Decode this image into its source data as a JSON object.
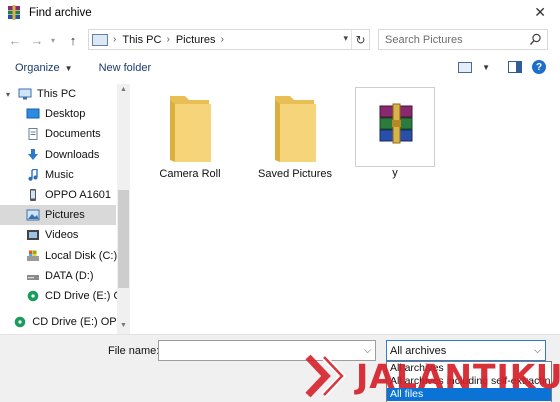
{
  "window": {
    "title": "Find archive"
  },
  "nav": {
    "breadcrumbs": [
      "This PC",
      "Pictures"
    ],
    "search_placeholder": "Search Pictures"
  },
  "toolbar": {
    "organize_label": "Organize",
    "new_folder_label": "New folder"
  },
  "sidebar": {
    "items": [
      {
        "label": "This PC",
        "icon": "computer-icon",
        "level": 0
      },
      {
        "label": "Desktop",
        "icon": "desktop-icon",
        "level": 1
      },
      {
        "label": "Documents",
        "icon": "documents-icon",
        "level": 1
      },
      {
        "label": "Downloads",
        "icon": "downloads-icon",
        "level": 1
      },
      {
        "label": "Music",
        "icon": "music-icon",
        "level": 1
      },
      {
        "label": "OPPO A1601",
        "icon": "phone-icon",
        "level": 1
      },
      {
        "label": "Pictures",
        "icon": "pictures-icon",
        "level": 1,
        "selected": true
      },
      {
        "label": "Videos",
        "icon": "videos-icon",
        "level": 1
      },
      {
        "label": "Local Disk (C:)",
        "icon": "local-disk-icon",
        "level": 1
      },
      {
        "label": "DATA (D:)",
        "icon": "drive-icon",
        "level": 1
      },
      {
        "label": "CD Drive (E:) OP",
        "icon": "cd-drive-icon",
        "level": 1
      },
      {
        "label": "CD Drive (E:) OPP",
        "icon": "cd-drive-icon",
        "level": 0
      }
    ]
  },
  "content": {
    "items": [
      {
        "label": "Camera Roll",
        "type": "folder"
      },
      {
        "label": "Saved Pictures",
        "type": "folder"
      },
      {
        "label": "y",
        "type": "archive"
      }
    ]
  },
  "footer": {
    "file_name_label": "File name:",
    "file_name_value": "",
    "file_type_selected": "All archives",
    "file_type_options": [
      "All archives",
      "All archives including self-extracting",
      "All files"
    ],
    "highlighted_option_index": 2
  },
  "watermark": {
    "text": "JALANTIKUS"
  },
  "colors": {
    "accent": "#0b72d6",
    "folder": "#f6d57a",
    "watermark": "#d5202a"
  }
}
